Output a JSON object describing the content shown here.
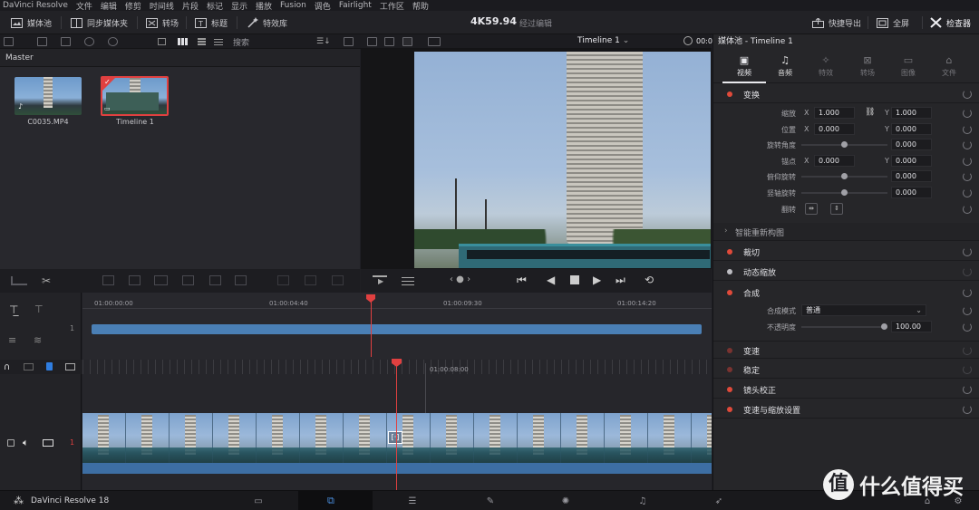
{
  "menu": [
    "DaVinci Resolve",
    "文件",
    "编辑",
    "修剪",
    "时间线",
    "片段",
    "标记",
    "显示",
    "播放",
    "Fusion",
    "调色",
    "Fairlight",
    "工作区",
    "帮助"
  ],
  "toolbar": {
    "media_pool": "媒体池",
    "sync_bin": "同步媒体夹",
    "transitions": "转场",
    "titles": "标题",
    "effects": "特效库",
    "timecode": "4K59.94",
    "status": "经过编辑",
    "quick_export": "快捷导出",
    "fullscreen": "全屏",
    "inspector": "检查器"
  },
  "subbar": {
    "search_placeholder": "搜索",
    "timeline_name": "Timeline 1",
    "timecode_partial": "00:0"
  },
  "media_pool": {
    "bin": "Master",
    "items": [
      {
        "name": "C0035.MP4",
        "selected": false
      },
      {
        "name": "Timeline 1",
        "selected": true
      }
    ]
  },
  "upper_timeline": {
    "track_number": "1",
    "ruler": [
      "01:00:00:00",
      "01:00:04:40",
      "01:00:09:30",
      "01:00:14:20"
    ]
  },
  "lower_timeline": {
    "track_number": "1",
    "ruler": [
      "01:00:08:00"
    ]
  },
  "inspector": {
    "title": "媒体池 - Timeline 1",
    "tabs": [
      {
        "label": "视频",
        "active": true
      },
      {
        "label": "音频",
        "active": false
      },
      {
        "label": "特效",
        "active": false
      },
      {
        "label": "转场",
        "active": false
      },
      {
        "label": "图像",
        "active": false
      },
      {
        "label": "文件",
        "active": false
      }
    ],
    "transform": {
      "title": "变换",
      "zoom_label": "缩放",
      "zoom_x": "1.000",
      "zoom_y": "1.000",
      "position_label": "位置",
      "position_x": "0.000",
      "position_y": "0.000",
      "rotation_label": "旋转角度",
      "rotation": "0.000",
      "anchor_label": "锚点",
      "anchor_x": "0.000",
      "anchor_y": "0.000",
      "pitch_label": "俯仰旋转",
      "pitch": "0.000",
      "yaw_label": "竖轴旋转",
      "yaw": "0.000",
      "flip_label": "翻转"
    },
    "smart_reframe": "智能重新构图",
    "crop": "裁切",
    "dynamic_zoom": "动态缩放",
    "composite": {
      "title": "合成",
      "mode_label": "合成模式",
      "mode": "普通",
      "opacity_label": "不透明度",
      "opacity": "100.00"
    },
    "speed": "变速",
    "stabilize": "稳定",
    "lens_correction": "镜头校正",
    "retime_scaling": "变速与缩放设置"
  },
  "pagebar": {
    "app": "DaVinci Resolve 18"
  },
  "watermark": {
    "logo": "值",
    "text": "什么值得买"
  },
  "colors": {
    "accent": "#e04040",
    "clip": "#4a7fb5",
    "panel": "#26262b"
  }
}
